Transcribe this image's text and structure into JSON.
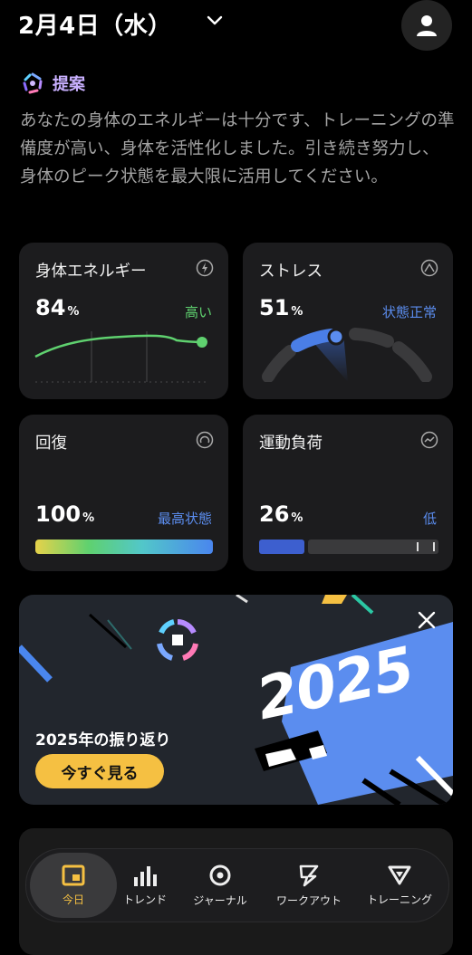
{
  "header": {
    "date": "2月4日（水）"
  },
  "suggestion": {
    "label": "提案",
    "text": "あなたの身体のエネルギーは十分です、トレーニングの準備度が高い、身体を活性化しました。引き続き努力し、身体のピーク状態を最大限に活用してください。"
  },
  "cards": {
    "energy": {
      "title": "身体エネルギー",
      "value": "84",
      "unit": "%",
      "status": "高い",
      "status_color": "#5fd16f"
    },
    "stress": {
      "title": "ストレス",
      "value": "51",
      "unit": "%",
      "status": "状態正常",
      "status_color": "#5b8def"
    },
    "recovery": {
      "title": "回復",
      "value": "100",
      "unit": "%",
      "status": "最高状態",
      "status_color": "#5b8def",
      "level": 1.0
    },
    "load": {
      "title": "運動負荷",
      "value": "26",
      "unit": "%",
      "status": "低",
      "status_color": "#5b8def",
      "level": 0.26
    }
  },
  "banner": {
    "headline": "2025",
    "title": "2025年の振り返り",
    "button": "今すぐ見る"
  },
  "tabbar": {
    "items": [
      {
        "label": "今日",
        "icon": "today-icon",
        "active": true
      },
      {
        "label": "トレンド",
        "icon": "bar-chart-icon",
        "active": false
      },
      {
        "label": "ジャーナル",
        "icon": "target-icon",
        "active": false
      },
      {
        "label": "ワークアウト",
        "icon": "lightning-icon",
        "active": false
      },
      {
        "label": "トレーニング",
        "icon": "triangle-icon",
        "active": false
      }
    ]
  },
  "colors": {
    "accent": "#f5c042",
    "blue": "#5b8def",
    "green": "#5fd16f",
    "purple": "#c9b0ff"
  }
}
